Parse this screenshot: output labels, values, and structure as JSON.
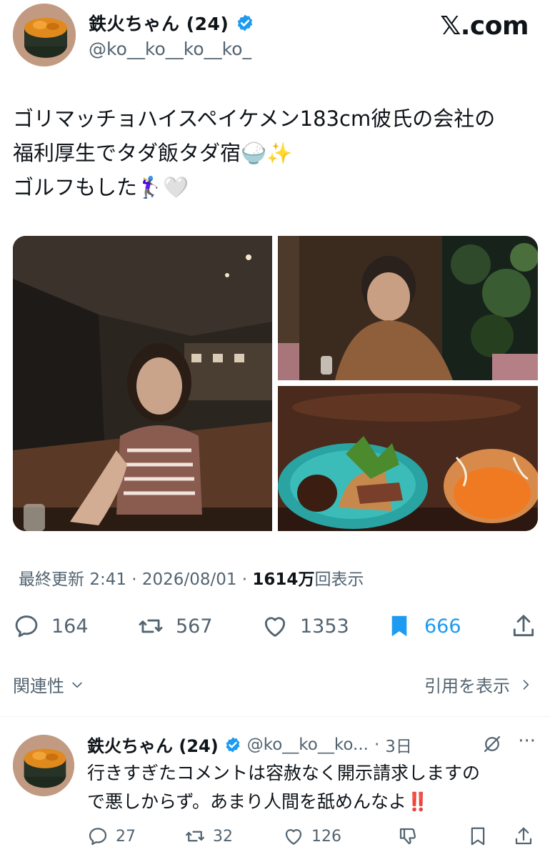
{
  "header": {
    "display_name": "鉄火ちゃん (24)",
    "handle": "@ko__ko__ko__ko_",
    "site_logo": "𝕏.com",
    "avatar_icon": "sushi-avatar-icon",
    "verified_icon": "verified-badge-icon"
  },
  "post": {
    "text": "ゴリマッチョハイスペイケメン183cm彼氏の会社の\n福利厚生でタダ飯タダ宿🍚✨\nゴルフもした🏌️‍♀️🤍",
    "media": [
      {
        "description_icon": "photo-woman-restaurant"
      },
      {
        "description_icon": "photo-man-dining"
      },
      {
        "description_icon": "photo-food-plate"
      }
    ],
    "meta": {
      "updated_label": "最終更新",
      "time": "2:41",
      "date": "2026/08/01",
      "sep": "·",
      "views_number": "1614",
      "views_unit": "万",
      "views_label": "回表示"
    },
    "actions": {
      "replies": "164",
      "reposts": "567",
      "likes": "1353",
      "bookmarks": "666"
    },
    "relevance_label": "関連性",
    "quotes_label": "引用を表示"
  },
  "reply": {
    "display_name": "鉄火ちゃん (24)",
    "handle": "@ko__ko__ko...",
    "sep": "·",
    "time": "3日",
    "more": "···",
    "text": "行きすぎたコメントは容赦なく開示請求しますの\nで悪しからず。あまり人間を舐めんなよ‼️",
    "actions": {
      "replies": "27",
      "reposts": "32",
      "likes": "126"
    }
  },
  "colors": {
    "accent": "#1d9bf0",
    "text": "#0f1419",
    "muted": "#536471"
  }
}
